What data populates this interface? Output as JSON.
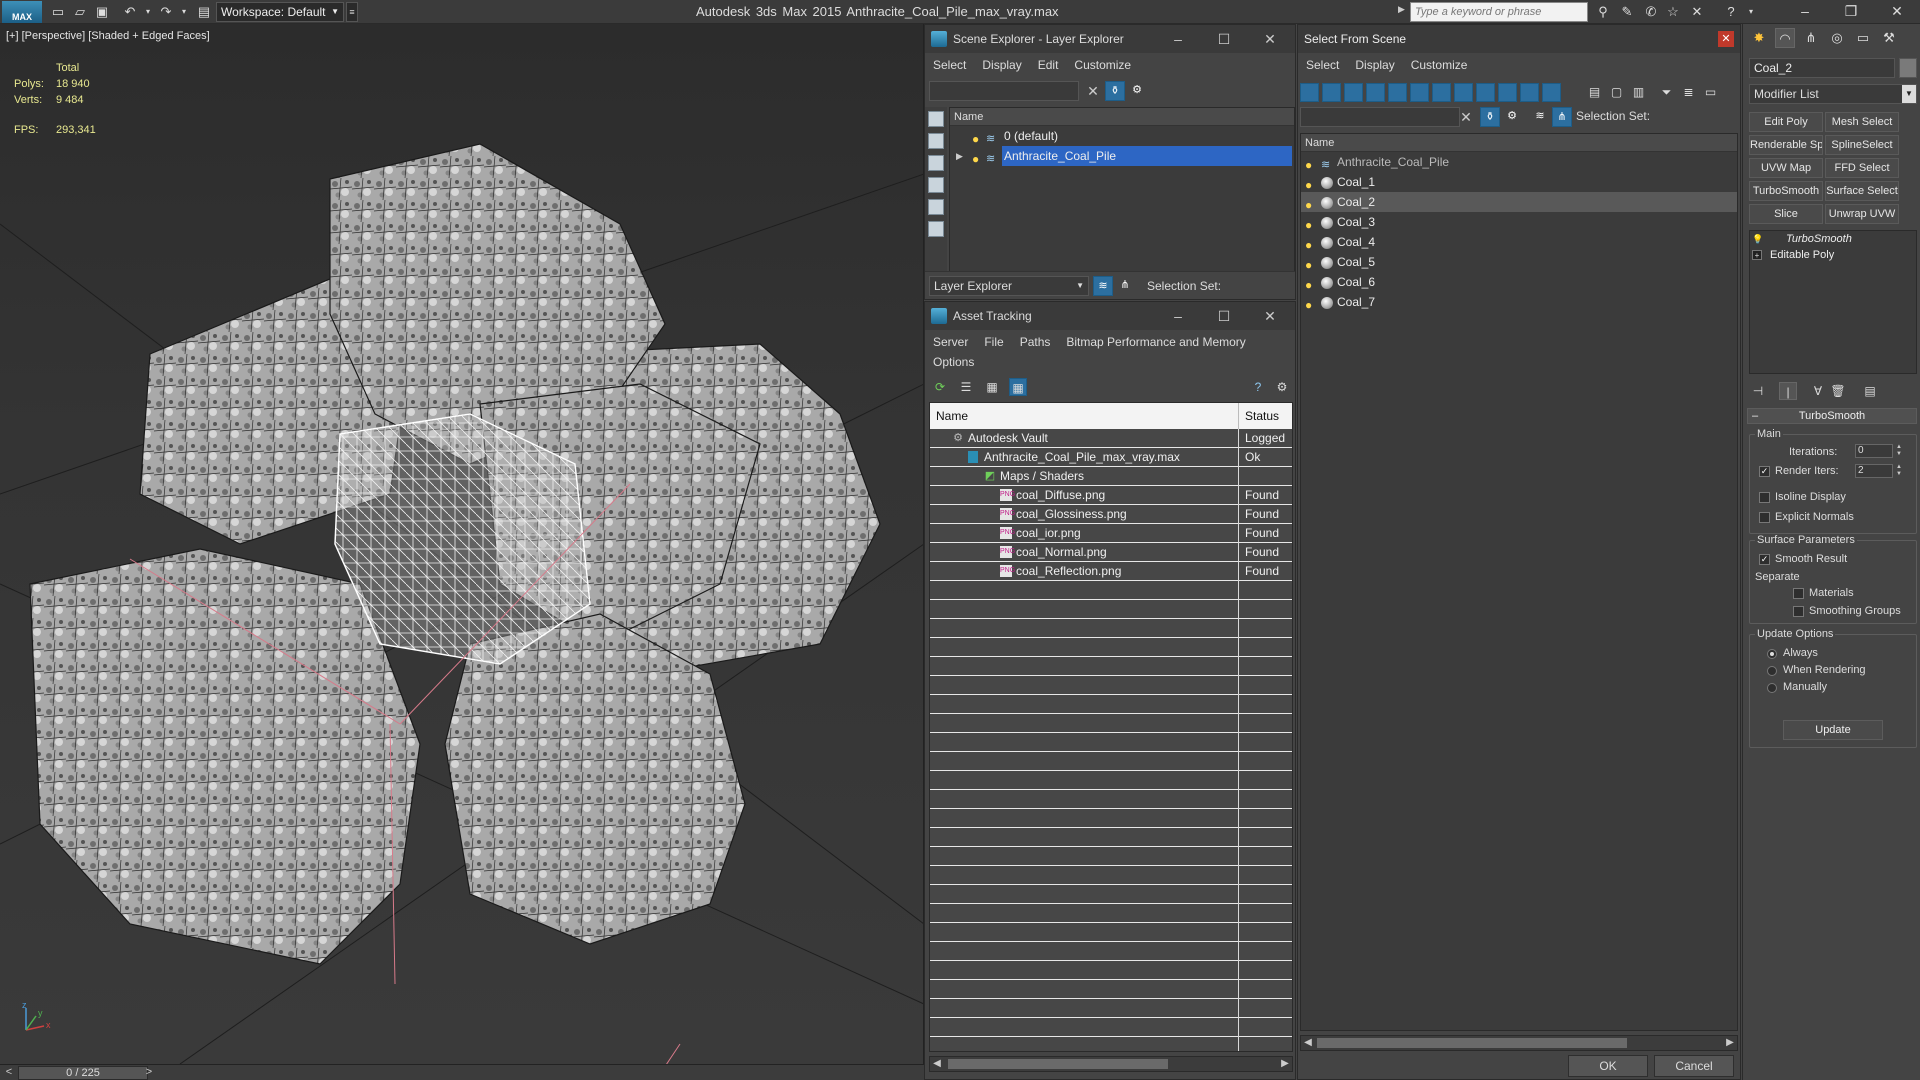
{
  "titlebar": {
    "logo": "MAX",
    "workspace_label": "Workspace: Default",
    "app_title": "Autodesk 3ds Max  2015      Anthracite_Coal_Pile_max_vray.max",
    "search_placeholder": "Type a keyword or phrase"
  },
  "viewport": {
    "label": "[+] [Perspective] [Shaded + Edged Faces]",
    "stats": {
      "header": "Total",
      "polys_label": "Polys:",
      "polys_value": "18 940",
      "verts_label": "Verts:",
      "verts_value": "9 484",
      "fps_label": "FPS:",
      "fps_value": "293,341"
    },
    "axes": {
      "x": "x",
      "y": "y",
      "z": "z"
    }
  },
  "timeline": {
    "frame_display": "0 / 225",
    "prev": "<",
    "next": ">"
  },
  "scene_explorer": {
    "title": "Scene Explorer - Layer Explorer",
    "menus": [
      "Select",
      "Display",
      "Edit",
      "Customize"
    ],
    "column_name": "Name",
    "rows": [
      {
        "label": "0 (default)",
        "selected": false
      },
      {
        "label": "Anthracite_Coal_Pile",
        "selected": true
      }
    ],
    "explorer_dropdown": "Layer Explorer",
    "selection_set_label": "Selection Set:"
  },
  "asset_tracking": {
    "title": "Asset Tracking",
    "menus_row1": [
      "Server",
      "File",
      "Paths",
      "Bitmap Performance and Memory"
    ],
    "menus_row2": [
      "Options"
    ],
    "col_name": "Name",
    "col_status": "Status",
    "rows": [
      {
        "name": "Autodesk Vault",
        "status": "Logged",
        "kind": "vault"
      },
      {
        "name": "Anthracite_Coal_Pile_max_vray.max",
        "status": "Ok",
        "kind": "max"
      },
      {
        "name": "Maps / Shaders",
        "status": "",
        "kind": "folder"
      },
      {
        "name": "coal_Diffuse.png",
        "status": "Found",
        "kind": "png"
      },
      {
        "name": "coal_Glossiness.png",
        "status": "Found",
        "kind": "png"
      },
      {
        "name": "coal_ior.png",
        "status": "Found",
        "kind": "png"
      },
      {
        "name": "coal_Normal.png",
        "status": "Found",
        "kind": "png"
      },
      {
        "name": "coal_Reflection.png",
        "status": "Found",
        "kind": "png"
      }
    ]
  },
  "select_from_scene": {
    "title": "Select From Scene",
    "menus": [
      "Select",
      "Display",
      "Customize"
    ],
    "selection_set_label": "Selection Set:",
    "column_name": "Name",
    "rows": [
      {
        "label": "Anthracite_Coal_Pile",
        "kind": "layer",
        "selected": false
      },
      {
        "label": "Coal_1",
        "kind": "object",
        "selected": false
      },
      {
        "label": "Coal_2",
        "kind": "object",
        "selected": true
      },
      {
        "label": "Coal_3",
        "kind": "object",
        "selected": false
      },
      {
        "label": "Coal_4",
        "kind": "object",
        "selected": false
      },
      {
        "label": "Coal_5",
        "kind": "object",
        "selected": false
      },
      {
        "label": "Coal_6",
        "kind": "object",
        "selected": false
      },
      {
        "label": "Coal_7",
        "kind": "object",
        "selected": false
      }
    ],
    "ok_label": "OK",
    "cancel_label": "Cancel"
  },
  "command_panel": {
    "object_name": "Coal_2",
    "modifier_list_label": "Modifier List",
    "modifier_buttons": [
      "Edit Poly",
      "Mesh Select",
      "Renderable Spline",
      "SplineSelect",
      "UVW Map",
      "FFD Select",
      "TurboSmooth",
      "Surface Select",
      "Slice",
      "Unwrap UVW"
    ],
    "stack": [
      {
        "label": "TurboSmooth",
        "kind": "modifier"
      },
      {
        "label": "Editable Poly",
        "kind": "base"
      }
    ],
    "rollout": {
      "title": "TurboSmooth",
      "main_label": "Main",
      "iterations_label": "Iterations:",
      "iterations_value": "0",
      "render_iters_label": "Render Iters:",
      "render_iters_value": "2",
      "render_iters_checked": true,
      "isoline_label": "Isoline Display",
      "explicit_normals_label": "Explicit Normals",
      "surface_params_label": "Surface Parameters",
      "smooth_result_label": "Smooth Result",
      "separate_label": "Separate",
      "materials_label": "Materials",
      "smoothing_groups_label": "Smoothing Groups",
      "update_options_label": "Update Options",
      "always_label": "Always",
      "when_rendering_label": "When Rendering",
      "manually_label": "Manually",
      "update_button": "Update"
    }
  },
  "colors": {
    "accent": "#2d66c4",
    "stats_text": "#e8e890",
    "bulb": "#ffd84a"
  }
}
